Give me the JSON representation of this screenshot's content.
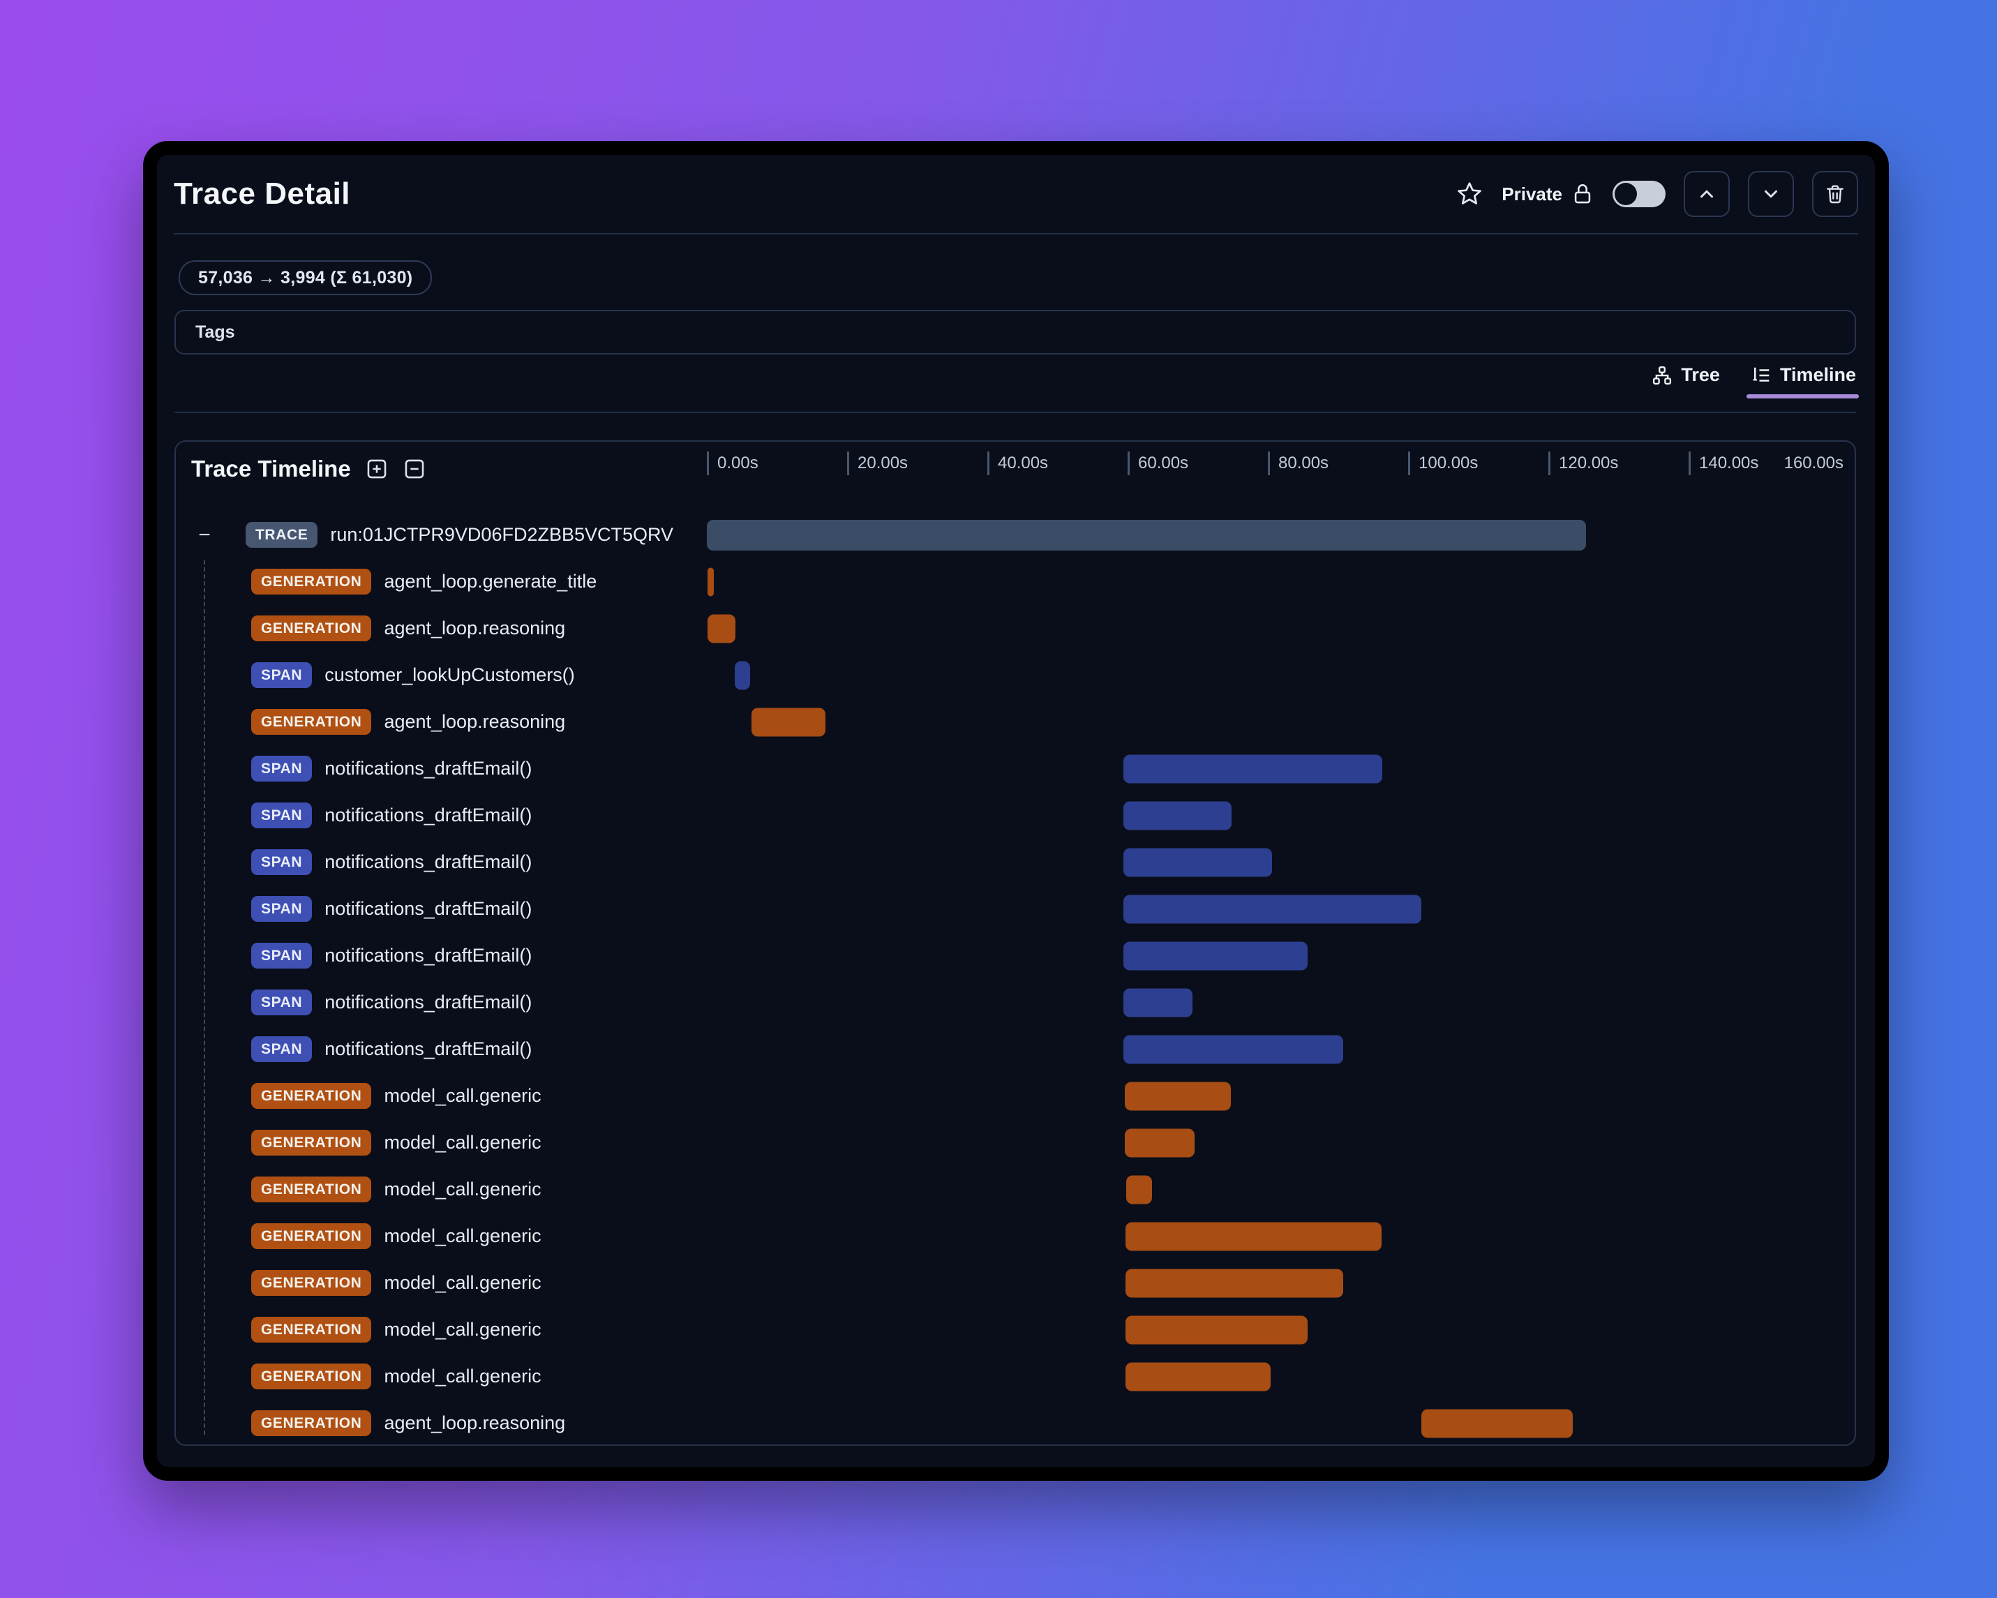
{
  "header": {
    "title": "Trace Detail",
    "privacy_label": "Private",
    "privacy_toggle_state": "off"
  },
  "token_badge": {
    "text": "57,036 → 3,994 (Σ 61,030)"
  },
  "tags": {
    "label": "Tags"
  },
  "tabs": [
    {
      "label": "Tree",
      "icon": "tree-icon",
      "active": false
    },
    {
      "label": "Timeline",
      "icon": "timeline-icon",
      "active": true
    }
  ],
  "colors": {
    "generation_orange_badge": "#b05113",
    "generation_orange_bar": "#a84d14",
    "span_blue_badge": "#3e50b4",
    "span_blue_bar": "#2d3f90",
    "trace_slate_badge": "#475771",
    "trace_slate_bar": "#3b4c66",
    "active_tab_underline": "#a78bda",
    "background_gradient": [
      "#9b4ced",
      "#4673e3"
    ]
  },
  "timeline": {
    "title": "Trace Timeline",
    "controls": [
      "expand-all-icon",
      "collapse-all-icon"
    ],
    "axis": {
      "tick_labels": [
        "0.00s",
        "20.00s",
        "40.00s",
        "60.00s",
        "80.00s",
        "100.00s",
        "120.00s",
        "140.00s"
      ],
      "end_label": "160.00s",
      "tick_interval_s": 20,
      "range_s": [
        0,
        160
      ]
    },
    "rows": [
      {
        "type": "TRACE",
        "kind": "trace",
        "name": "run:01JCTPR9VD06FD2ZBB5VCT5QRV",
        "root": true,
        "start_s": 0.0,
        "end_s": 125.4
      },
      {
        "type": "GENERATION",
        "kind": "generation",
        "name": "agent_loop.generate_title",
        "start_s": 0.1,
        "end_s": 1.0
      },
      {
        "type": "GENERATION",
        "kind": "generation",
        "name": "agent_loop.reasoning",
        "start_s": 0.1,
        "end_s": 4.1
      },
      {
        "type": "SPAN",
        "kind": "span",
        "name": "customer_lookUpCustomers()",
        "start_s": 4.0,
        "end_s": 6.2
      },
      {
        "type": "GENERATION",
        "kind": "generation",
        "name": "agent_loop.reasoning",
        "start_s": 6.4,
        "end_s": 16.9
      },
      {
        "type": "SPAN",
        "kind": "span",
        "name": "notifications_draftEmail()",
        "start_s": 59.4,
        "end_s": 96.3
      },
      {
        "type": "SPAN",
        "kind": "span",
        "name": "notifications_draftEmail()",
        "start_s": 59.4,
        "end_s": 74.8
      },
      {
        "type": "SPAN",
        "kind": "span",
        "name": "notifications_draftEmail()",
        "start_s": 59.4,
        "end_s": 80.6
      },
      {
        "type": "SPAN",
        "kind": "span",
        "name": "notifications_draftEmail()",
        "start_s": 59.4,
        "end_s": 101.9
      },
      {
        "type": "SPAN",
        "kind": "span",
        "name": "notifications_draftEmail()",
        "start_s": 59.4,
        "end_s": 85.7
      },
      {
        "type": "SPAN",
        "kind": "span",
        "name": "notifications_draftEmail()",
        "start_s": 59.4,
        "end_s": 69.3
      },
      {
        "type": "SPAN",
        "kind": "span",
        "name": "notifications_draftEmail()",
        "start_s": 59.4,
        "end_s": 90.7
      },
      {
        "type": "GENERATION",
        "kind": "generation",
        "name": "model_call.generic",
        "start_s": 59.6,
        "end_s": 74.7
      },
      {
        "type": "GENERATION",
        "kind": "generation",
        "name": "model_call.generic",
        "start_s": 59.6,
        "end_s": 69.6
      },
      {
        "type": "GENERATION",
        "kind": "generation",
        "name": "model_call.generic",
        "start_s": 59.8,
        "end_s": 63.5
      },
      {
        "type": "GENERATION",
        "kind": "generation",
        "name": "model_call.generic",
        "start_s": 59.7,
        "end_s": 96.2
      },
      {
        "type": "GENERATION",
        "kind": "generation",
        "name": "model_call.generic",
        "start_s": 59.7,
        "end_s": 90.7
      },
      {
        "type": "GENERATION",
        "kind": "generation",
        "name": "model_call.generic",
        "start_s": 59.7,
        "end_s": 85.7
      },
      {
        "type": "GENERATION",
        "kind": "generation",
        "name": "model_call.generic",
        "start_s": 59.7,
        "end_s": 80.4
      },
      {
        "type": "GENERATION",
        "kind": "generation",
        "name": "agent_loop.reasoning",
        "start_s": 101.9,
        "end_s": 123.5
      }
    ]
  }
}
